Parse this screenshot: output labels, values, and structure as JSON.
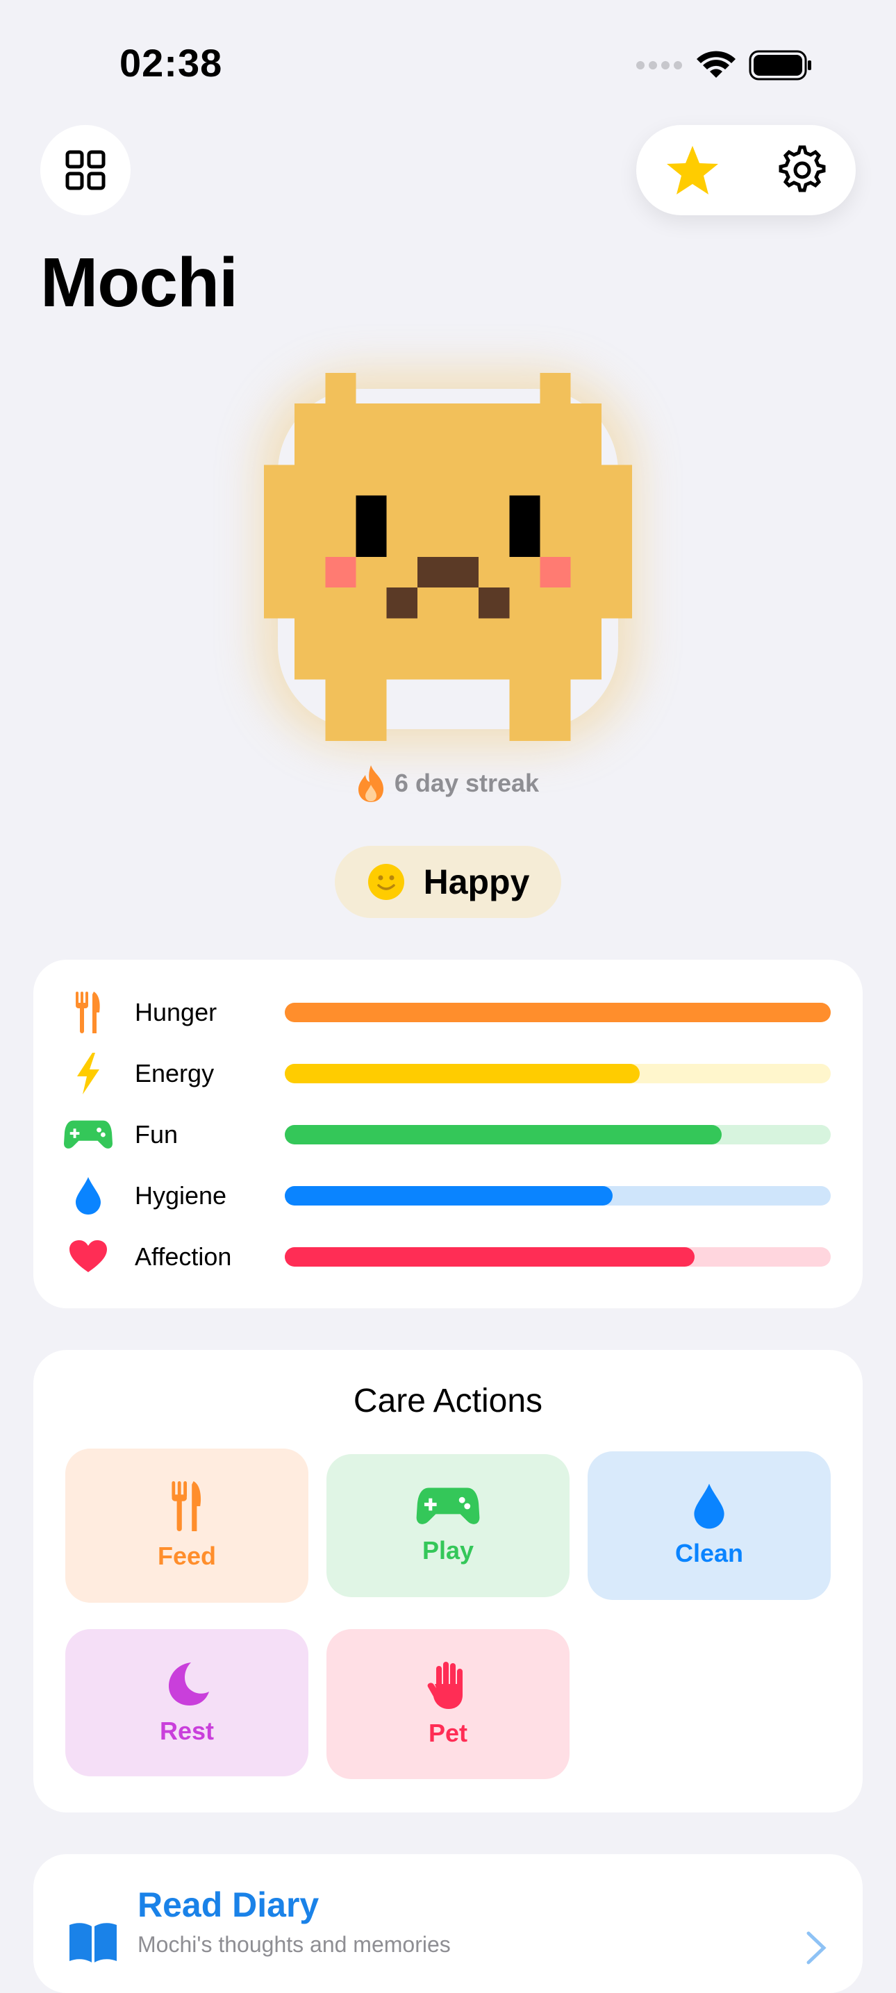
{
  "status_bar": {
    "time": "02:38"
  },
  "header": {
    "grid_icon": "grid-icon",
    "star_icon": "star-icon",
    "gear_icon": "gear-icon"
  },
  "pet": {
    "name": "Mochi",
    "streak": "6 day streak",
    "mood": "Happy"
  },
  "stats": [
    {
      "label": "Hunger",
      "icon": "fork-knife-icon",
      "level": 1.0,
      "color": "#FF8E2C",
      "track": "#FFE6D1"
    },
    {
      "label": "Energy",
      "icon": "bolt-icon",
      "level": 0.65,
      "color": "#FFCC00",
      "track": "#FFF6CC"
    },
    {
      "label": "Fun",
      "icon": "gamepad-icon",
      "level": 0.8,
      "color": "#34C759",
      "track": "#D7F4DE"
    },
    {
      "label": "Hygiene",
      "icon": "drop-icon",
      "level": 0.6,
      "color": "#0A84FF",
      "track": "#CFE5FB"
    },
    {
      "label": "Affection",
      "icon": "heart-icon",
      "level": 0.75,
      "color": "#FF2D55",
      "track": "#FFD6DE"
    }
  ],
  "actions": {
    "title": "Care Actions",
    "items": [
      {
        "label": "Feed",
        "icon": "fork-knife-icon",
        "color": "#FF8E2C",
        "bg": "#FFECDF"
      },
      {
        "label": "Play",
        "icon": "gamepad-icon",
        "color": "#34C759",
        "bg": "#E0F5E5"
      },
      {
        "label": "Clean",
        "icon": "drop-icon",
        "color": "#0A84FF",
        "bg": "#D9EAFB"
      },
      {
        "label": "Rest",
        "icon": "moon-icon",
        "color": "#C93FDB",
        "bg": "#F5DFF7"
      },
      {
        "label": "Pet",
        "icon": "hand-icon",
        "color": "#FF2D55",
        "bg": "#FFDFE5"
      }
    ]
  },
  "diary": {
    "title": "Read Diary",
    "subtitle": "Mochi's thoughts and memories",
    "icon": "book-icon",
    "chevron": "chevron-right-icon"
  }
}
